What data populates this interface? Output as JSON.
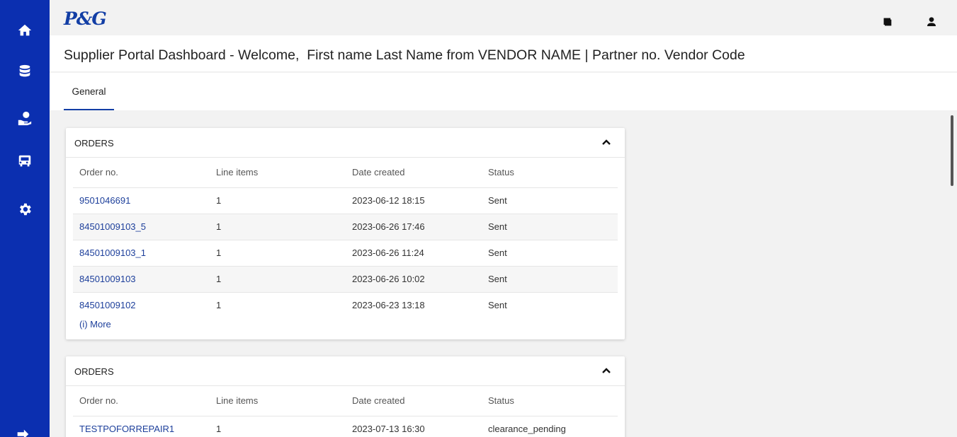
{
  "sidebar": {
    "icons": [
      "home-icon",
      "database-icon",
      "help-hand-icon",
      "truck-icon",
      "settings-icon",
      "logout-icon"
    ]
  },
  "header": {
    "logo": "P&G",
    "icons": [
      "window-icon",
      "user-icon"
    ]
  },
  "page": {
    "title_prefix": "Supplier Portal Dashboard - Welcome,",
    "title_user": "First name Last Name from VENDOR NAME | Partner no. Vendor Code"
  },
  "tabs": [
    {
      "label": "General",
      "active": true
    }
  ],
  "cards": [
    {
      "title": "ORDERS",
      "columns": [
        "Order no.",
        "Line items",
        "Date created",
        "Status"
      ],
      "rows": [
        {
          "order": "9501046691",
          "items": "1",
          "date": "2023-06-12 18:15",
          "status": "Sent"
        },
        {
          "order": "84501009103_5",
          "items": "1",
          "date": "2023-06-26 17:46",
          "status": "Sent"
        },
        {
          "order": "84501009103_1",
          "items": "1",
          "date": "2023-06-26 11:24",
          "status": "Sent"
        },
        {
          "order": "84501009103",
          "items": "1",
          "date": "2023-06-26 10:02",
          "status": "Sent"
        },
        {
          "order": "84501009102",
          "items": "1",
          "date": "2023-06-23 13:18",
          "status": "Sent"
        }
      ],
      "more_label": "(i) More"
    },
    {
      "title": "ORDERS",
      "columns": [
        "Order no.",
        "Line items",
        "Date created",
        "Status"
      ],
      "rows": [
        {
          "order": "TESTPOFORREPAIR1",
          "items": "1",
          "date": "2023-07-13 16:30",
          "status": "clearance_pending"
        }
      ]
    }
  ],
  "colors": {
    "sidebar": "#0b2fb0",
    "accent": "#123ea5",
    "link": "#1d3f9b"
  }
}
